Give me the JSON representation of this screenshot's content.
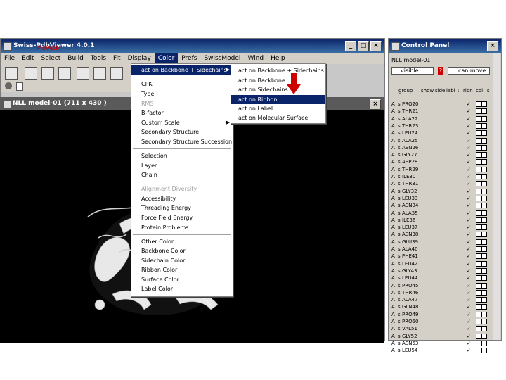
{
  "main_window": {
    "title": "Swiss-PdbViewer 4.0.1",
    "menu": [
      "File",
      "Edit",
      "Select",
      "Build",
      "Tools",
      "Fit",
      "Display",
      "Color",
      "Prefs",
      "SwissModel",
      "Wind",
      "Help"
    ],
    "active_menu": "Color",
    "move_label": "Move:M",
    "viewer_title": "NLL model-01  (711 x 430 )"
  },
  "color_menu": {
    "items": [
      {
        "label": "act on Backbone + Sidechains",
        "submenu": true,
        "highlighted": true
      },
      {
        "label": "CPK"
      },
      {
        "label": "Type"
      },
      {
        "label": "RMS",
        "disabled": true
      },
      {
        "label": "B-factor"
      },
      {
        "label": "Custom Scale",
        "submenu": true
      },
      {
        "label": "Secondary Structure"
      },
      {
        "label": "Secondary Structure Succession"
      },
      {
        "label": "Selection"
      },
      {
        "label": "Layer"
      },
      {
        "label": "Chain"
      },
      {
        "label": "Alignment Diversity",
        "disabled": true
      },
      {
        "label": "Accessibility"
      },
      {
        "label": "Threading Energy"
      },
      {
        "label": "Force Field Energy"
      },
      {
        "label": "Protein Problems"
      },
      {
        "label": "Other Color"
      },
      {
        "label": "Backbone Color"
      },
      {
        "label": "Sidechain Color"
      },
      {
        "label": "Ribbon Color"
      },
      {
        "label": "Surface Color"
      },
      {
        "label": "Label Color"
      }
    ]
  },
  "submenu": {
    "items": [
      {
        "label": "act on Backbone + Sidechains"
      },
      {
        "label": "act on Backbone"
      },
      {
        "label": "act on Sidechains"
      },
      {
        "label": "act on Ribbon",
        "highlighted": true
      },
      {
        "label": "act on Label"
      },
      {
        "label": "act on Molecular Surface"
      }
    ]
  },
  "control_panel": {
    "title": "Control Panel",
    "model": "NLL model-01",
    "visible_label": "visible",
    "help_label": "?",
    "can_move_label": "can move",
    "columns": [
      "group",
      "show",
      "side",
      "labl",
      "::",
      "ribn",
      "col",
      "s"
    ],
    "residues": [
      "PRO20",
      "THR21",
      "ALA22",
      "THR23",
      "LEU24",
      "ALA25",
      "ASN26",
      "GLY27",
      "ASP28",
      "THR29",
      "ILE30",
      "THR31",
      "GLY32",
      "LEU33",
      "ASN34",
      "ALA35",
      "ILE36",
      "LEU37",
      "ASN38",
      "GLU39",
      "ALA40",
      "PHE41",
      "LEU42",
      "GLY43",
      "LEU44",
      "PRO45",
      "THR46",
      "ALA47",
      "GLN48",
      "PRO49",
      "PRO50",
      "VAL51",
      "GLY52",
      "ASN53",
      "LEU54"
    ],
    "chain": "A",
    "ss": "s",
    "check": "✓"
  },
  "colors": {
    "highlight": "#0a246a",
    "arrow": "#cc0000",
    "viewer_bg": "#000000"
  }
}
